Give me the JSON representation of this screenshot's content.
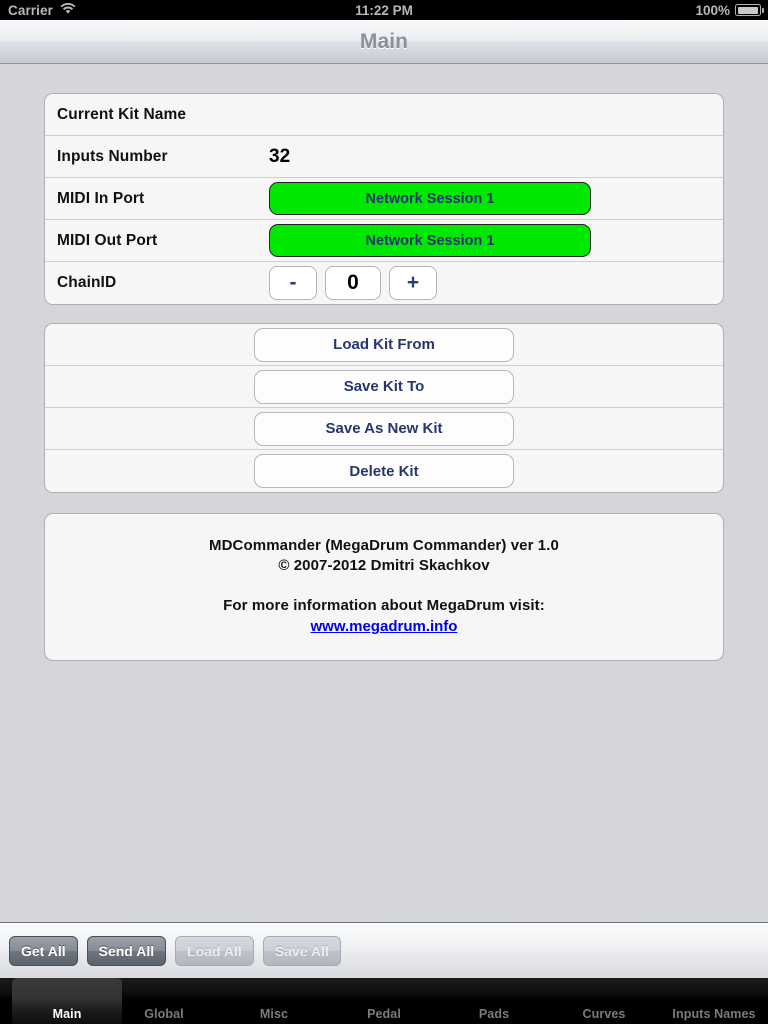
{
  "status_bar": {
    "carrier": "Carrier",
    "wifi_icon": "wifi-icon",
    "time": "11:22 PM",
    "battery_percent": "100%",
    "battery_icon": "battery-icon"
  },
  "nav_bar": {
    "title": "Main"
  },
  "settings_table": {
    "rows": [
      {
        "label": "Current Kit Name",
        "value": "",
        "type": "text"
      },
      {
        "label": "Inputs Number",
        "value": "32",
        "type": "text"
      },
      {
        "label": "MIDI In Port",
        "value": "Network Session 1",
        "type": "green-button",
        "color": "#00e800"
      },
      {
        "label": "MIDI Out Port",
        "value": "Network Session 1",
        "type": "green-button",
        "color": "#00e800"
      },
      {
        "label": "ChainID",
        "value": "0",
        "type": "stepper",
        "decrement": "-",
        "increment": "+"
      }
    ]
  },
  "actions_table": {
    "buttons": [
      {
        "label": "Load Kit From"
      },
      {
        "label": "Save Kit To"
      },
      {
        "label": "Save As New Kit"
      },
      {
        "label": "Delete Kit"
      }
    ]
  },
  "about": {
    "line1": "MDCommander (MegaDrum Commander) ver 1.0",
    "line2": "© 2007-2012 Dmitri Skachkov",
    "line3": "For more information about MegaDrum visit:",
    "link": "www.megadrum.info",
    "link_color": "#0000ee"
  },
  "toolbar": {
    "buttons": [
      {
        "label": "Get All",
        "enabled": true
      },
      {
        "label": "Send All",
        "enabled": true
      },
      {
        "label": "Load All",
        "enabled": false
      },
      {
        "label": "Save All",
        "enabled": false
      }
    ]
  },
  "tab_bar": {
    "selected_index": 0,
    "tabs": [
      {
        "label": "Main"
      },
      {
        "label": "Global"
      },
      {
        "label": "Misc"
      },
      {
        "label": "Pedal"
      },
      {
        "label": "Pads"
      },
      {
        "label": "Curves"
      },
      {
        "label": "Inputs Names"
      }
    ]
  }
}
